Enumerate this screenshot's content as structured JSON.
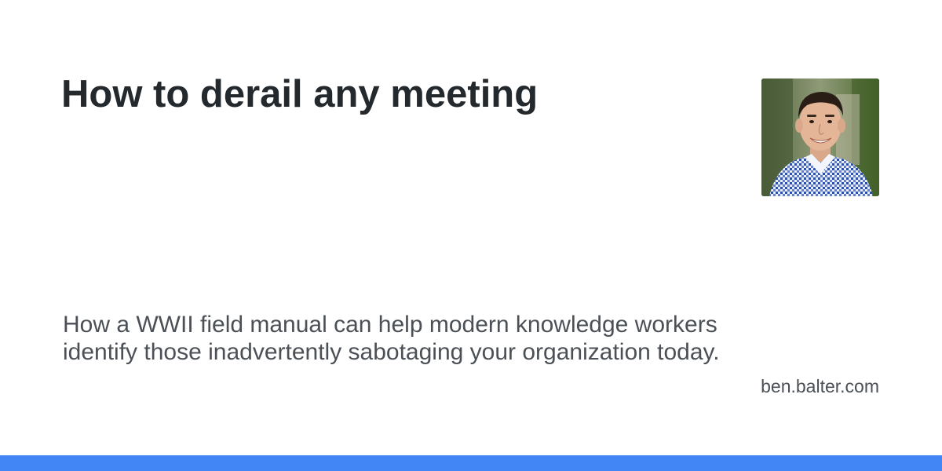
{
  "card": {
    "title": "How to derail any meeting",
    "description": "How a WWII field manual can help modern knowledge workers identify those inadvertently sabotaging your organization today.",
    "domain": "ben.balter.com"
  },
  "avatar": {
    "icon": "author-photo"
  },
  "colors": {
    "title": "#24292e",
    "text": "#4b5056",
    "accent_bar": "#4285f4",
    "background": "#ffffff"
  }
}
